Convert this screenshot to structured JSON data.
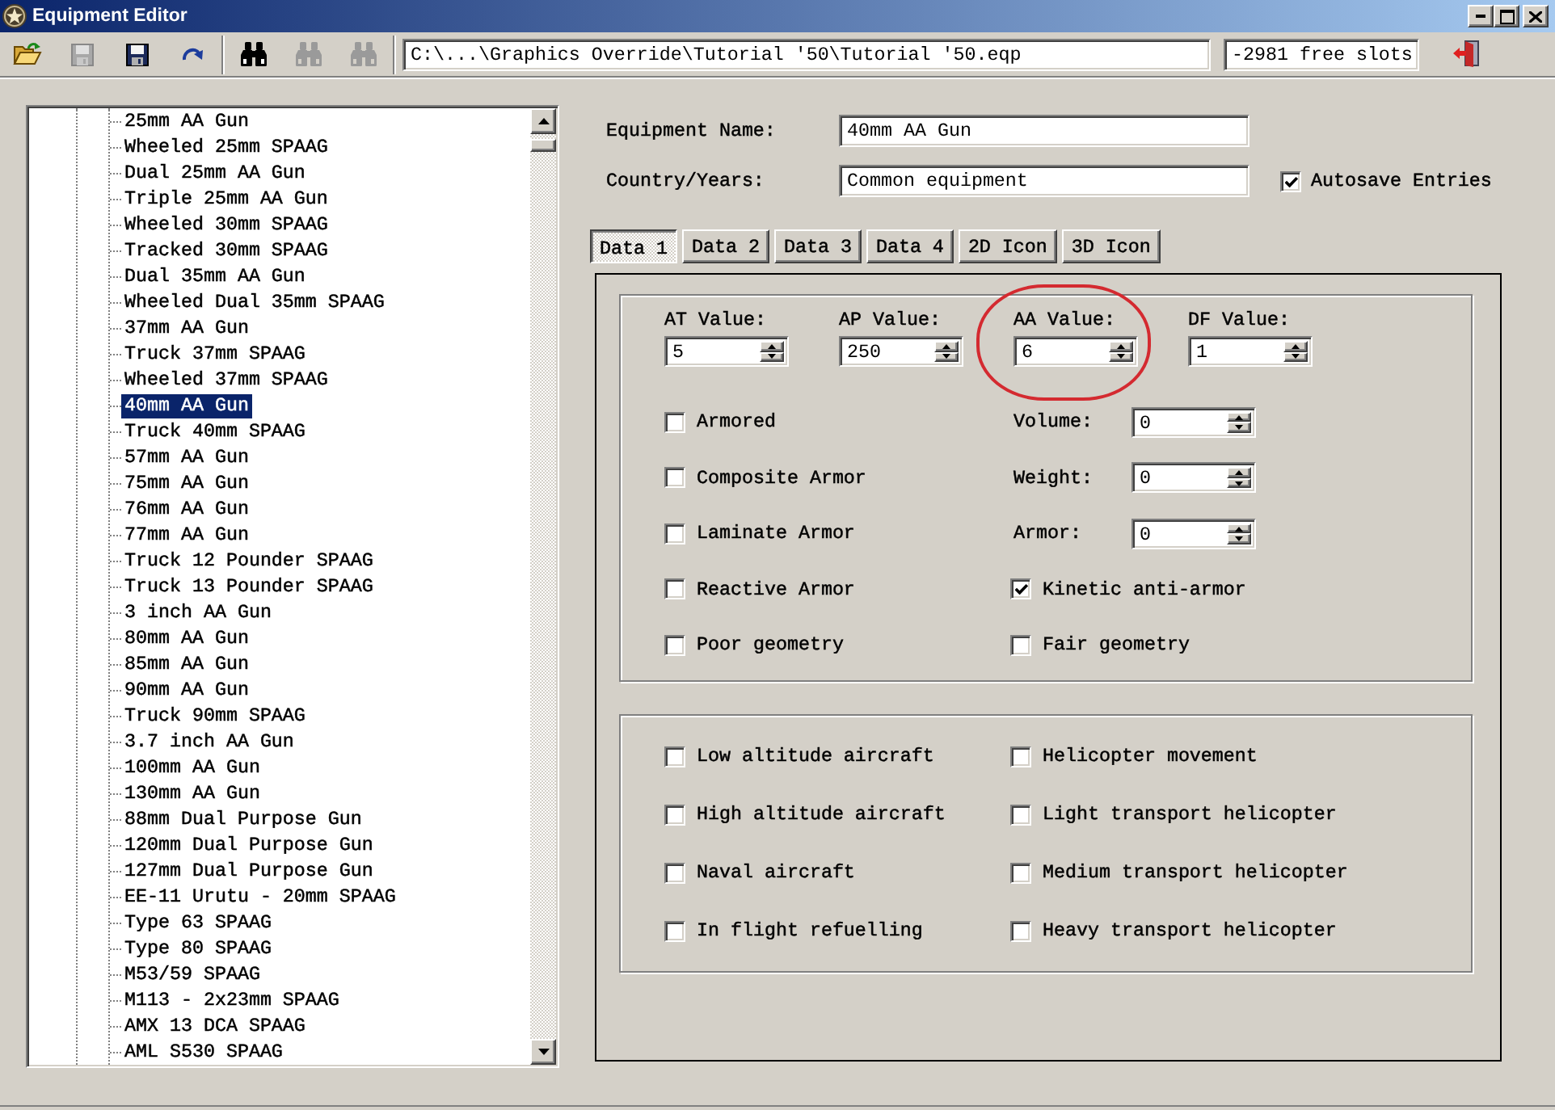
{
  "window": {
    "title": "Equipment Editor"
  },
  "toolbar": {
    "left_items": [
      {
        "kind": "open",
        "disabled": false
      },
      {
        "kind": "save",
        "disabled": true
      },
      {
        "kind": "save",
        "disabled": false
      },
      {
        "kind": "redo",
        "disabled": false
      },
      {
        "kind": "separator"
      },
      {
        "kind": "find",
        "disabled": false
      },
      {
        "kind": "find",
        "disabled": true
      },
      {
        "kind": "find",
        "disabled": true
      },
      {
        "kind": "separator"
      }
    ],
    "path": "C:\\...\\Graphics Override\\Tutorial '50\\Tutorial '50.eqp",
    "free_slots": "-2981 free slots",
    "right_items": [
      {
        "kind": "exit",
        "disabled": false
      }
    ]
  },
  "tree": {
    "items": [
      {
        "label": "25mm AA Gun",
        "selected": false
      },
      {
        "label": "Wheeled 25mm SPAAG",
        "selected": false
      },
      {
        "label": "Dual 25mm AA Gun",
        "selected": false
      },
      {
        "label": "Triple 25mm AA Gun",
        "selected": false
      },
      {
        "label": "Wheeled 30mm SPAAG",
        "selected": false
      },
      {
        "label": "Tracked 30mm SPAAG",
        "selected": false
      },
      {
        "label": "Dual 35mm AA Gun",
        "selected": false
      },
      {
        "label": "Wheeled Dual 35mm SPAAG",
        "selected": false
      },
      {
        "label": "37mm AA Gun",
        "selected": false
      },
      {
        "label": "Truck 37mm SPAAG",
        "selected": false
      },
      {
        "label": "Wheeled 37mm SPAAG",
        "selected": false
      },
      {
        "label": "40mm AA Gun",
        "selected": true
      },
      {
        "label": "Truck 40mm SPAAG",
        "selected": false
      },
      {
        "label": "57mm AA Gun",
        "selected": false
      },
      {
        "label": "75mm AA Gun",
        "selected": false
      },
      {
        "label": "76mm AA Gun",
        "selected": false
      },
      {
        "label": "77mm AA Gun",
        "selected": false
      },
      {
        "label": "Truck 12 Pounder SPAAG",
        "selected": false
      },
      {
        "label": "Truck 13 Pounder SPAAG",
        "selected": false
      },
      {
        "label": "3 inch AA Gun",
        "selected": false
      },
      {
        "label": "80mm AA Gun",
        "selected": false
      },
      {
        "label": "85mm AA Gun",
        "selected": false
      },
      {
        "label": "90mm AA Gun",
        "selected": false
      },
      {
        "label": "Truck 90mm SPAAG",
        "selected": false
      },
      {
        "label": "3.7 inch AA Gun",
        "selected": false
      },
      {
        "label": "100mm AA Gun",
        "selected": false
      },
      {
        "label": "130mm AA Gun",
        "selected": false
      },
      {
        "label": "88mm Dual Purpose Gun",
        "selected": false
      },
      {
        "label": "120mm Dual Purpose Gun",
        "selected": false
      },
      {
        "label": "127mm Dual Purpose Gun",
        "selected": false
      },
      {
        "label": "EE-11 Urutu - 20mm SPAAG",
        "selected": false
      },
      {
        "label": "Type 63 SPAAG",
        "selected": false
      },
      {
        "label": "Type 80 SPAAG",
        "selected": false
      },
      {
        "label": "M53/59 SPAAG",
        "selected": false
      },
      {
        "label": "M113 - 2x23mm SPAAG",
        "selected": false
      },
      {
        "label": "AMX 13 DCA SPAAG",
        "selected": false
      },
      {
        "label": "AML S530 SPAAG",
        "selected": false
      }
    ]
  },
  "form": {
    "fields": [
      {
        "label": "Equipment Name:",
        "value": "40mm AA Gun"
      },
      {
        "label": "Country/Years:",
        "value": "Common equipment"
      }
    ],
    "autosave": {
      "label": "Autosave Entries",
      "checked": true
    }
  },
  "tabs": [
    {
      "label": "Data 1",
      "selected": true
    },
    {
      "label": "Data 2",
      "selected": false
    },
    {
      "label": "Data 3",
      "selected": false
    },
    {
      "label": "Data 4",
      "selected": false
    },
    {
      "label": "2D Icon",
      "selected": false
    },
    {
      "label": "3D Icon",
      "selected": false
    }
  ],
  "data_tab": {
    "values": [
      {
        "label": "AT Value:",
        "value": "5",
        "highlighted": false
      },
      {
        "label": "AP Value:",
        "value": "250",
        "highlighted": false
      },
      {
        "label": "AA Value:",
        "value": "6",
        "highlighted": true
      },
      {
        "label": "DF Value:",
        "value": "1",
        "highlighted": false
      }
    ],
    "left_column": [
      {
        "label": "Armored",
        "checked": false
      },
      {
        "label": "Composite Armor",
        "checked": false
      },
      {
        "label": "Laminate Armor",
        "checked": false
      },
      {
        "label": "Reactive Armor",
        "checked": false
      },
      {
        "label": "Poor geometry",
        "checked": false
      }
    ],
    "right_column": [
      {
        "kind": "spin",
        "label": "Volume:",
        "value": "0"
      },
      {
        "kind": "spin",
        "label": "Weight:",
        "value": "0"
      },
      {
        "kind": "spin",
        "label": "Armor:",
        "value": "0"
      },
      {
        "kind": "check",
        "label": "Kinetic anti-armor",
        "checked": true
      },
      {
        "kind": "check",
        "label": "Fair geometry",
        "checked": false
      }
    ]
  },
  "movement_group": {
    "left_column": [
      {
        "label": "Low altitude aircraft",
        "checked": false
      },
      {
        "label": "High altitude aircraft",
        "checked": false
      },
      {
        "label": "Naval aircraft",
        "checked": false
      },
      {
        "label": "In flight refuelling",
        "checked": false
      }
    ],
    "right_column": [
      {
        "label": "Helicopter movement",
        "checked": false
      },
      {
        "label": "Light transport helicopter",
        "checked": false
      },
      {
        "label": "Medium transport helicopter",
        "checked": false
      },
      {
        "label": "Heavy transport helicopter",
        "checked": false
      }
    ]
  }
}
